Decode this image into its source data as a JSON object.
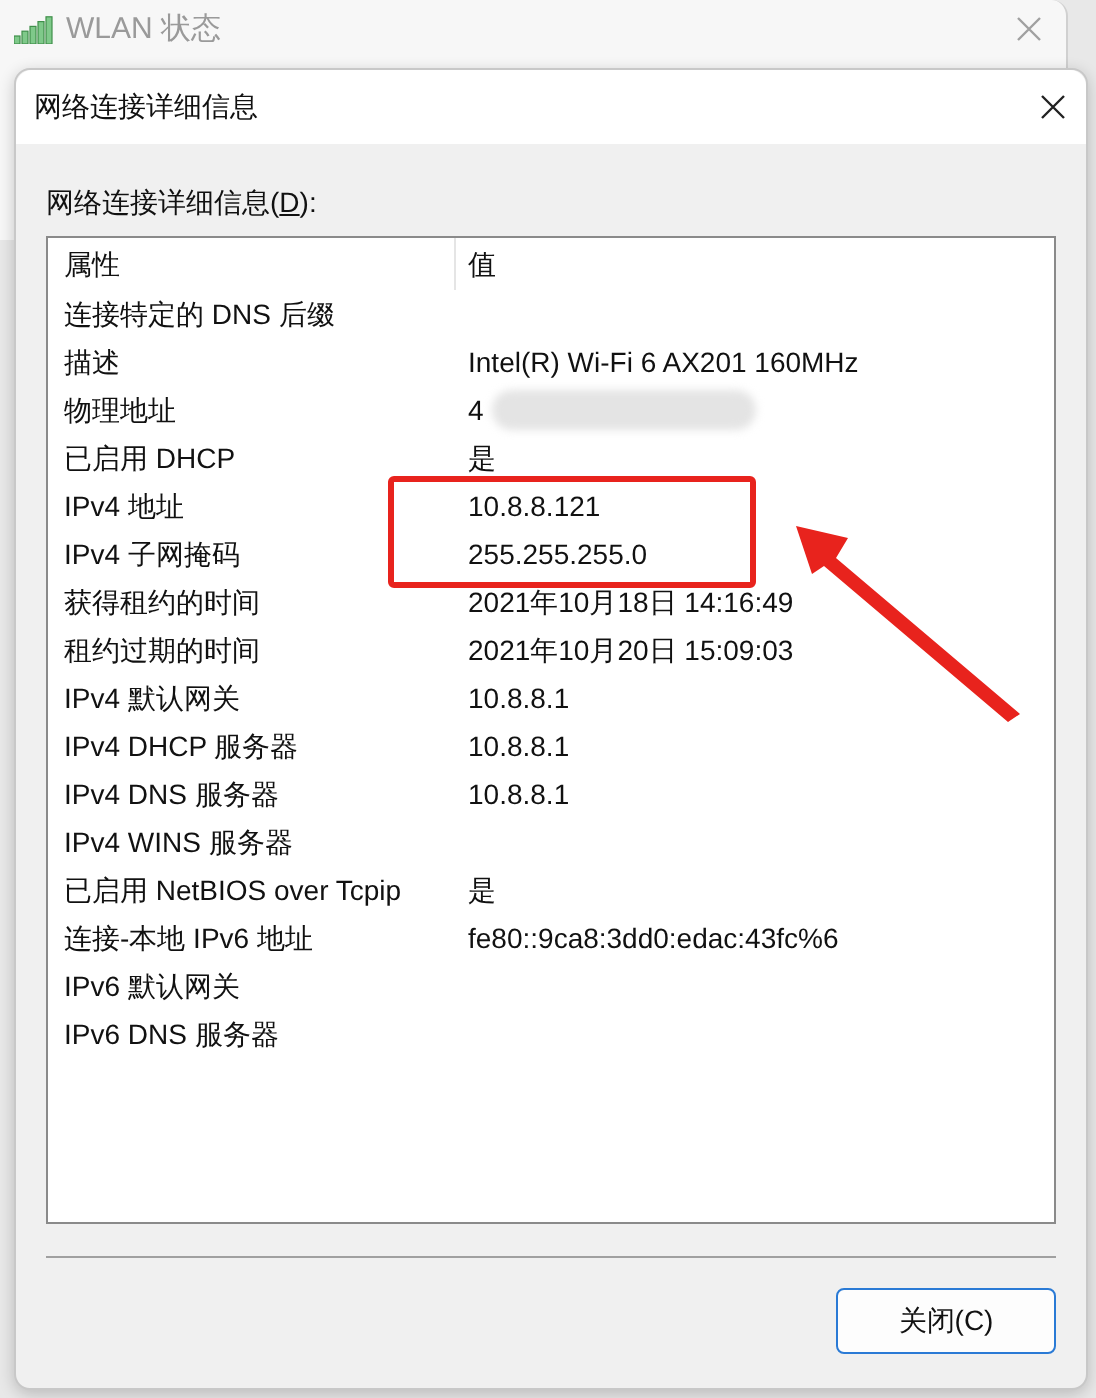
{
  "back_window": {
    "title": "WLAN 状态"
  },
  "dialog": {
    "title": "网络连接详细信息",
    "list_label": {
      "before": "网络连接详细信息(",
      "access_key": "D",
      "after": "):"
    },
    "columns": [
      "属性",
      "值"
    ],
    "rows": [
      {
        "property": "连接特定的 DNS 后缀",
        "blurred": false,
        "highlighted": false
      },
      {
        "property": "描述",
        "value": "Intel(R) Wi-Fi 6 AX201 160MHz",
        "blurred": false,
        "highlighted": false
      },
      {
        "property": "物理地址",
        "value": "4",
        "blurred": true,
        "highlighted": false
      },
      {
        "property": "已启用 DHCP",
        "value": "是",
        "blurred": false,
        "highlighted": false
      },
      {
        "property": "IPv4 地址",
        "value": "10.8.8.121",
        "blurred": false,
        "highlighted": true
      },
      {
        "property": "IPv4 子网掩码",
        "value": "255.255.255.0",
        "blurred": false,
        "highlighted": true
      },
      {
        "property": "获得租约的时间",
        "value": "2021年10月18日 14:16:49",
        "blurred": false,
        "highlighted": false
      },
      {
        "property": "租约过期的时间",
        "value": "2021年10月20日 15:09:03",
        "blurred": false,
        "highlighted": false
      },
      {
        "property": "IPv4 默认网关",
        "value": "10.8.8.1",
        "blurred": false,
        "highlighted": false
      },
      {
        "property": "IPv4 DHCP 服务器",
        "value": "10.8.8.1",
        "blurred": false,
        "highlighted": false
      },
      {
        "property": "IPv4 DNS 服务器",
        "value": "10.8.8.1",
        "blurred": false,
        "highlighted": false
      },
      {
        "property": "IPv4 WINS 服务器",
        "blurred": false,
        "highlighted": false
      },
      {
        "property": "已启用 NetBIOS over Tcpip",
        "value": "是",
        "blurred": false,
        "highlighted": false
      },
      {
        "property": "连接-本地 IPv6 地址",
        "value": "fe80::9ca8:3dd0:edac:43fc%6",
        "blurred": false,
        "highlighted": false
      },
      {
        "property": "IPv6 默认网关",
        "blurred": false,
        "highlighted": false
      },
      {
        "property": "IPv6 DNS 服务器",
        "blurred": false,
        "highlighted": false
      }
    ],
    "buttons": [
      "关闭(C)"
    ]
  }
}
